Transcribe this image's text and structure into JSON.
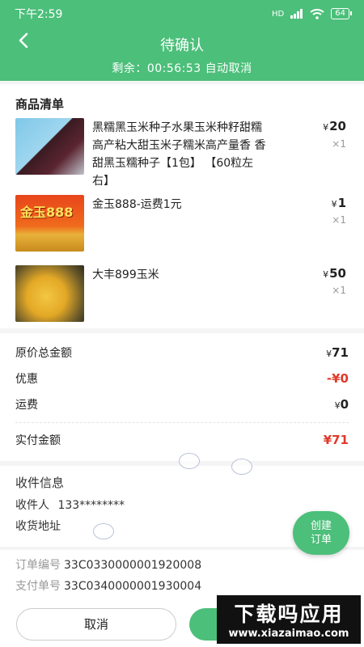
{
  "status_bar": {
    "time": "下午2:59",
    "signal": "HD",
    "battery": "64"
  },
  "header": {
    "back_icon": "chevron-left-icon",
    "title": "待确认",
    "countdown": "剩余：00:56:53 自动取消"
  },
  "goods": {
    "section_title": "商品清单",
    "items": [
      {
        "name": "黑糯黑玉米种子水果玉米种籽甜糯高产粘大甜玉米子糯米高产量香 香甜黑玉糯种子【1包】 【60粒左右】",
        "currency": "¥",
        "price": "20",
        "qty": "×1"
      },
      {
        "name": "金玉888-运费1元",
        "currency": "¥",
        "price": "1",
        "qty": "×1",
        "image_text": "金玉888"
      },
      {
        "name": "大丰899玉米",
        "currency": "¥",
        "price": "50",
        "qty": "×1"
      }
    ]
  },
  "amounts": {
    "original_label": "原价总金额",
    "original_currency": "¥",
    "original_value": "71",
    "discount_label": "优惠",
    "discount_value": "-¥0",
    "shipping_label": "运费",
    "shipping_currency": "¥",
    "shipping_value": "0",
    "paid_label": "实付金额",
    "paid_value": "¥71"
  },
  "receiver": {
    "section_title": "收件信息",
    "name_label": "收件人",
    "name_value": "133********",
    "address_label": "收货地址"
  },
  "create_order_button": "创建\n订单",
  "order_info": {
    "order_no_label": "订单编号",
    "order_no": "33C0330000001920008",
    "pay_no_label": "支付单号",
    "pay_no": "33C0340000001930004"
  },
  "bottom": {
    "cancel_label": "取消"
  },
  "watermark": {
    "line1": "下载吗应用",
    "line2": "www.xiazaimao.com"
  },
  "colors": {
    "brand_green": "#4cbf7a",
    "price_red": "#e03a2b"
  }
}
